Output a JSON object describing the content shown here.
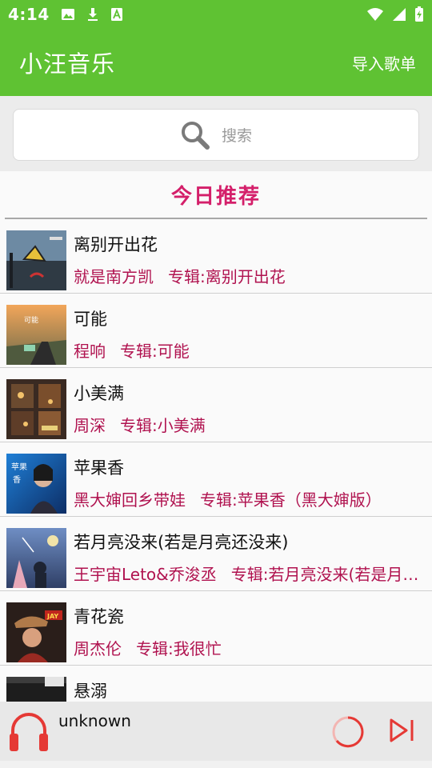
{
  "status_bar": {
    "time": "4:14",
    "left_icons": [
      "image-icon",
      "download-icon",
      "text-a-icon"
    ],
    "right_icons": [
      "wifi-icon",
      "signal-icon",
      "battery-charging-icon"
    ]
  },
  "app_bar": {
    "title": "小汪音乐",
    "action_label": "导入歌单"
  },
  "search": {
    "placeholder": "搜索",
    "icon": "search-icon"
  },
  "section": {
    "title": "今日推荐"
  },
  "songs": [
    {
      "title": "离别开出花",
      "artist": "就是南方凯",
      "album": "专辑:离别开出花"
    },
    {
      "title": "可能",
      "artist": "程响",
      "album": "专辑:可能"
    },
    {
      "title": "小美满",
      "artist": "周深",
      "album": "专辑:小美满"
    },
    {
      "title": "苹果香",
      "artist": "黑大婶回乡带娃",
      "album": "专辑:苹果香（黑大婶版）"
    },
    {
      "title": "若月亮没来(若是月亮还没来)",
      "artist": "王宇宙Leto&乔浚丞",
      "album": "专辑:若月亮没来(若是月亮还没来)"
    },
    {
      "title": "青花瓷",
      "artist": "周杰伦",
      "album": "专辑:我很忙"
    },
    {
      "title": "悬溺",
      "artist": "",
      "album": ""
    }
  ],
  "player": {
    "track": "unknown",
    "accent_color": "#e53935"
  },
  "colors": {
    "primary": "#5fc233",
    "accent_text": "#b0124f",
    "section_title": "#d41f6a"
  }
}
